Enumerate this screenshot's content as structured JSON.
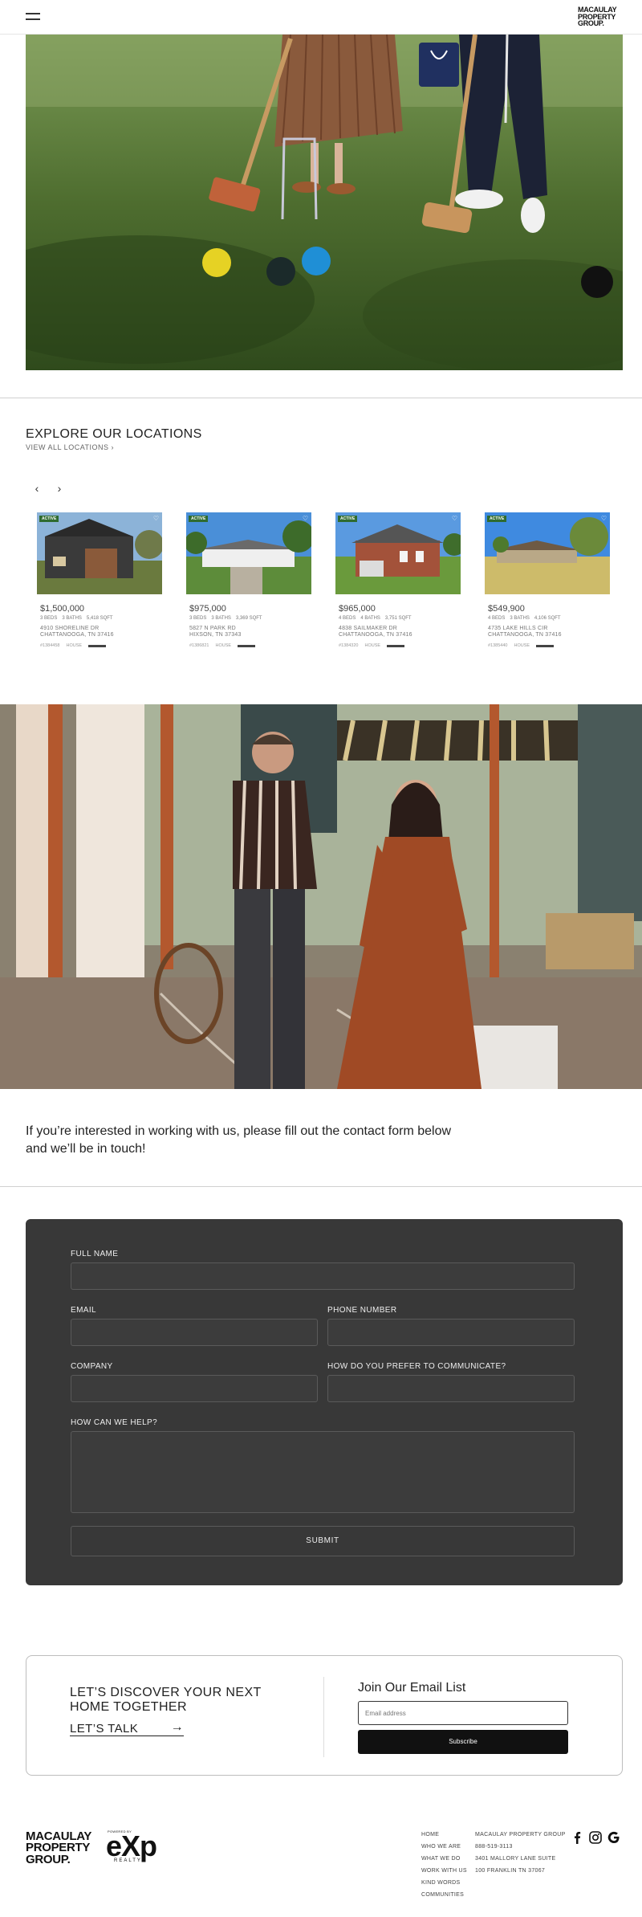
{
  "header": {
    "logo_lines": [
      "MACAULAY",
      "PROPERTY",
      "GROUP."
    ]
  },
  "locations": {
    "title": "EXPLORE OUR LOCATIONS",
    "view_all": "VIEW ALL LOCATIONS ›",
    "prev": "‹",
    "next": "›",
    "listings": [
      {
        "badge": "ACTIVE",
        "price": "$1,500,000",
        "beds": "3 BEDS",
        "baths": "3 BATHS",
        "sqft": "5,418 SQFT",
        "address1": "4910 SHORELINE DR",
        "address2": "CHATTANOOGA, TN 37416",
        "mls": "#1384458",
        "type": "HOUSE"
      },
      {
        "badge": "ACTIVE",
        "price": "$975,000",
        "beds": "3 BEDS",
        "baths": "3 BATHS",
        "sqft": "3,369 SQFT",
        "address1": "5827 N PARK RD",
        "address2": "HIXSON, TN 37343",
        "mls": "#1386821",
        "type": "HOUSE"
      },
      {
        "badge": "ACTIVE",
        "price": "$965,000",
        "beds": "4 BEDS",
        "baths": "4 BATHS",
        "sqft": "3,751 SQFT",
        "address1": "4838 SAILMAKER DR",
        "address2": "CHATTANOOGA, TN 37416",
        "mls": "#1384320",
        "type": "HOUSE"
      },
      {
        "badge": "ACTIVE",
        "price": "$549,900",
        "beds": "4 BEDS",
        "baths": "3 BATHS",
        "sqft": "4,106 SQFT",
        "address1": "4735 LAKE HILLS CIR",
        "address2": "CHATTANOOGA, TN 37416",
        "mls": "#1385440",
        "type": "HOUSE"
      }
    ]
  },
  "contact": {
    "intro": "If you’re interested in working with us, please fill out the contact form below and we’ll be in touch!"
  },
  "form": {
    "full_name": "FULL NAME",
    "email": "EMAIL",
    "phone": "PHONE NUMBER",
    "company": "COMPANY",
    "communicate": "HOW DO YOU PREFER TO COMMUNICATE?",
    "help": "HOW CAN WE HELP?",
    "submit": "SUBMIT"
  },
  "discover": {
    "title": "LET’S DISCOVER YOUR NEXT HOME TOGETHER",
    "talk": "LET’S TALK",
    "arrow": "→",
    "email_title": "Join Our Email List",
    "email_placeholder": "Email address",
    "subscribe": "Subscribe"
  },
  "footer": {
    "logo_lines": [
      "MACAULAY",
      "PROPERTY",
      "GROUP."
    ],
    "exp_small": "POWERED BY",
    "exp": "eXp",
    "exp_realty": "REALTY",
    "nav": [
      "HOME",
      "WHO WE ARE",
      "WHAT WE DO",
      "WORK WITH US",
      "KIND WORDS",
      "COMMUNITIES"
    ],
    "info": [
      "MACAULAY PROPERTY GROUP",
      "888-519-3113",
      "3401 MALLORY LANE SUITE",
      "100 FRANKLIN TN 37067"
    ],
    "social": [
      "facebook-icon",
      "instagram-icon",
      "google-icon"
    ]
  }
}
